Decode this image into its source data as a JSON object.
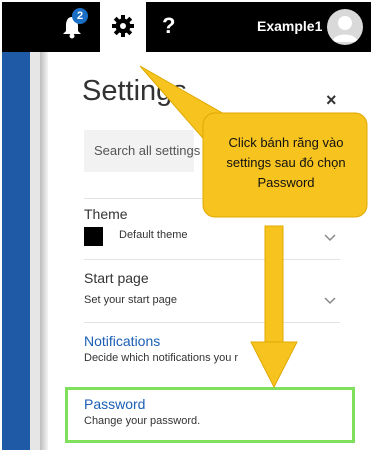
{
  "header": {
    "notification_count": "2",
    "username": "Example1",
    "help_label": "?"
  },
  "settings": {
    "title": "Settings",
    "close_label": "×",
    "search_placeholder": "Search all settings",
    "sections": [
      {
        "title": "Theme",
        "subtitle": "Default theme"
      },
      {
        "title": "Start page",
        "subtitle": "Set your start page"
      },
      {
        "title": "Notifications",
        "subtitle": "Decide which notifications you r"
      },
      {
        "title": "Password",
        "subtitle": "Change your password."
      }
    ]
  },
  "callout": {
    "text": "Click bánh răng vào settings sau đó chọn Password"
  },
  "colors": {
    "topbar": "#000000",
    "badge": "#1a6fc4",
    "link": "#1a5fb4",
    "callout": "#f7c31f",
    "highlight": "#7fe05b"
  },
  "icons": [
    "bell-icon",
    "gear-icon",
    "avatar-icon",
    "close-icon",
    "chevron-down-icon"
  ]
}
